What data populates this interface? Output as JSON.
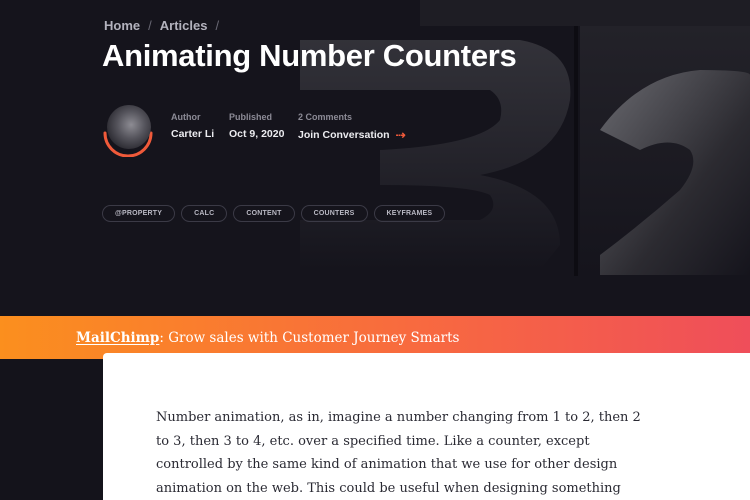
{
  "breadcrumb": {
    "items": [
      "Home",
      "Articles"
    ],
    "separator": "/"
  },
  "title": "Animating Number Counters",
  "author": {
    "label": "Author",
    "name": "Carter Li"
  },
  "published": {
    "label": "Published",
    "date": "Oct 9, 2020"
  },
  "comments": {
    "label": "2 Comments",
    "link": "Join Conversation"
  },
  "tags": [
    "@PROPERTY",
    "CALC",
    "CONTENT",
    "COUNTERS",
    "KEYFRAMES"
  ],
  "promo": {
    "brand": "MailChimp",
    "text": ": Grow sales with Customer Journey Smarts"
  },
  "article": {
    "body": "Number animation, as in, imagine a number changing from 1 to 2, then 2 to 3, then 3 to 4, etc. over a specified time. Like a counter, except controlled by the same kind of animation that we use for other design animation on the web. This could be useful when designing something"
  },
  "colors": {
    "accent": "#f05a3a",
    "promo_start": "#fb8f1e",
    "promo_end": "#ef4e5a"
  },
  "icons": {
    "join_arrow": "arrow-right-icon"
  }
}
